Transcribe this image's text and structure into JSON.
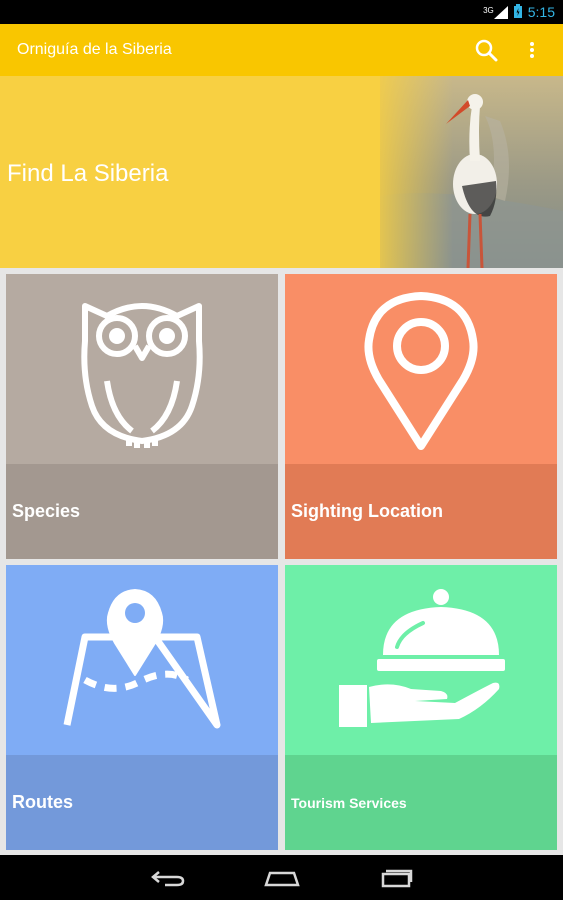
{
  "status_bar": {
    "network": "3G",
    "time": "5:15",
    "accent": "#33b5e5"
  },
  "app_bar": {
    "title": "Orniguía de la Siberia",
    "color": "#f9c600",
    "actions": [
      "search-icon",
      "overflow-menu-icon"
    ]
  },
  "hero": {
    "title": "Find La Siberia",
    "color": "#f8d042"
  },
  "tiles": [
    {
      "label": "Species",
      "icon": "owl-icon",
      "color": "#b5aaa1",
      "band_color": "#a39890"
    },
    {
      "label": "Sighting Location",
      "icon": "map-pin-icon",
      "color": "#f98e66",
      "band_color": "#e17b55"
    },
    {
      "label": "Routes",
      "icon": "route-map-icon",
      "color": "#7facf5",
      "band_color": "#7399da"
    },
    {
      "label": "Tourism Services",
      "icon": "food-service-icon",
      "color": "#6eefa8",
      "band_color": "#5fd48f"
    }
  ],
  "nav_bar": {
    "buttons": [
      "back-icon",
      "home-icon",
      "recent-apps-icon"
    ]
  }
}
